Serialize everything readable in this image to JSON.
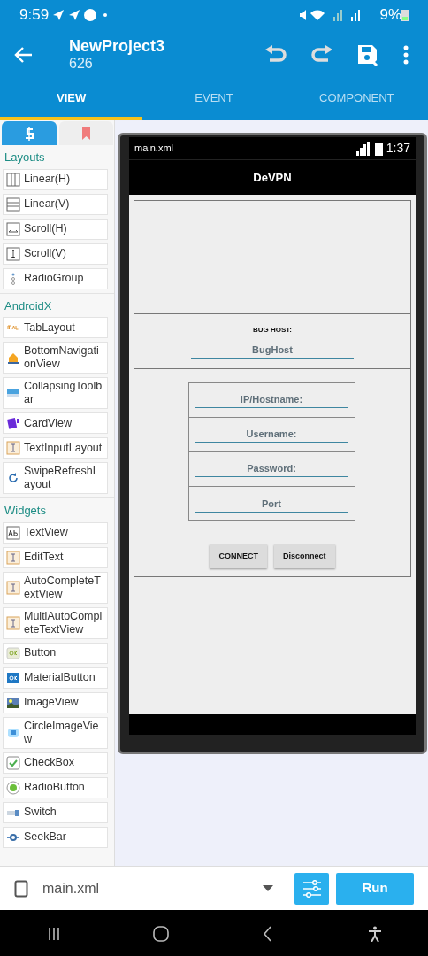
{
  "status_bar": {
    "time": "9:59",
    "battery": "9%"
  },
  "toolbar": {
    "title": "NewProject3",
    "subtitle": "626"
  },
  "tabs": [
    {
      "label": "VIEW",
      "selected": true
    },
    {
      "label": "EVENT",
      "selected": false
    },
    {
      "label": "COMPONENT",
      "selected": false
    }
  ],
  "palette_tabs": [
    {
      "selected": true
    },
    {
      "selected": false
    }
  ],
  "palette": [
    {
      "title": "Layouts",
      "items": [
        {
          "label": "Linear(H)"
        },
        {
          "label": "Linear(V)"
        },
        {
          "label": "Scroll(H)"
        },
        {
          "label": "Scroll(V)"
        },
        {
          "label": "RadioGroup"
        }
      ]
    },
    {
      "title": "AndroidX",
      "items": [
        {
          "label": "TabLayout"
        },
        {
          "label": "BottomNavigationView"
        },
        {
          "label": "CollapsingToolbar"
        },
        {
          "label": "CardView"
        },
        {
          "label": "TextInputLayout"
        },
        {
          "label": "SwipeRefreshLayout"
        }
      ]
    },
    {
      "title": "Widgets",
      "items": [
        {
          "label": "TextView"
        },
        {
          "label": "EditText"
        },
        {
          "label": "AutoCompleteTextView"
        },
        {
          "label": "MultiAutoCompleteTextView"
        },
        {
          "label": "Button"
        },
        {
          "label": "MaterialButton"
        },
        {
          "label": "ImageView"
        },
        {
          "label": "CircleImageView"
        },
        {
          "label": "CheckBox"
        },
        {
          "label": "RadioButton"
        },
        {
          "label": "Switch"
        },
        {
          "label": "SeekBar"
        }
      ]
    }
  ],
  "preview": {
    "file": "main.xml",
    "time": "1:37",
    "app_title": "DeVPN",
    "bug_host_label": "BUG HOST:",
    "bug_host_field": {
      "placeholder": "BugHost"
    },
    "fields": [
      {
        "placeholder": "IP/Hostname:"
      },
      {
        "placeholder": "Username:"
      },
      {
        "placeholder": "Password:"
      },
      {
        "placeholder": "Port"
      }
    ],
    "buttons": [
      "CONNECT",
      "Disconnect"
    ]
  },
  "bottom_bar": {
    "file": "main.xml",
    "run": "Run"
  }
}
